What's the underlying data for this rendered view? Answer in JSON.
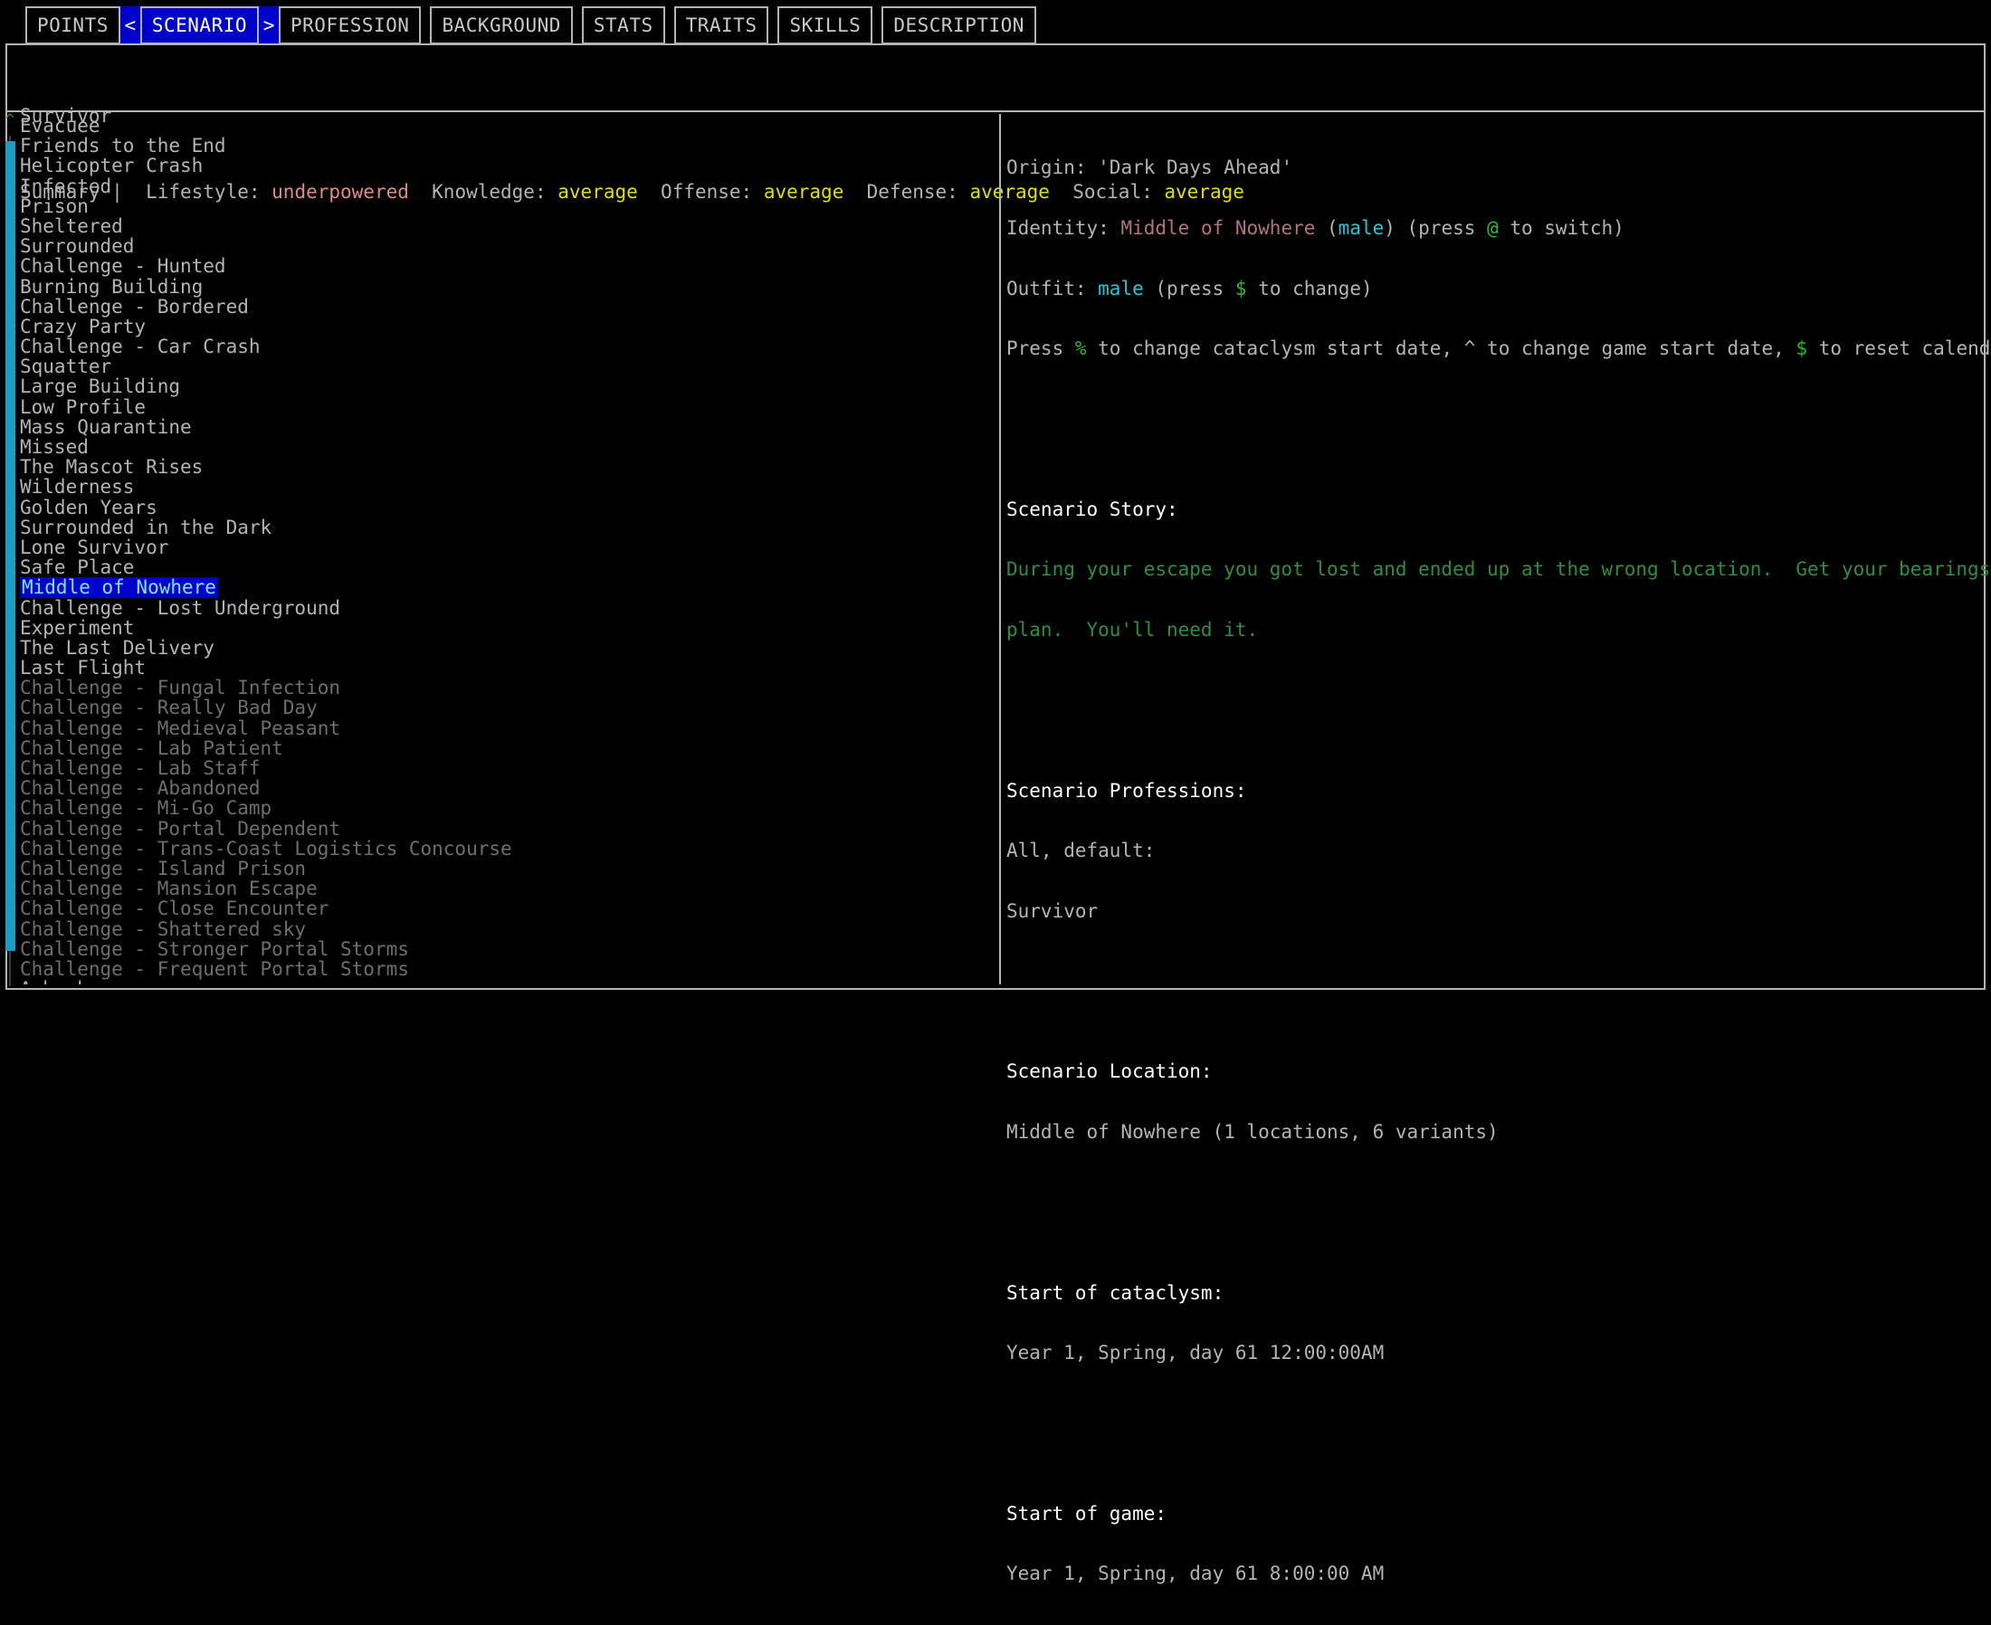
{
  "tabs": [
    {
      "label": "POINTS",
      "active": false
    },
    {
      "label": "SCENARIO",
      "active": true
    },
    {
      "label": "PROFESSION",
      "active": false
    },
    {
      "label": "BACKGROUND",
      "active": false
    },
    {
      "label": "STATS",
      "active": false
    },
    {
      "label": "TRAITS",
      "active": false
    },
    {
      "label": "SKILLS",
      "active": false
    },
    {
      "label": "DESCRIPTION",
      "active": false
    }
  ],
  "tab_arrows": {
    "left": "<",
    "right": ">"
  },
  "summary": {
    "profession": "Survivor",
    "prefix": "Summary |  ",
    "lifestyle_label": "Lifestyle: ",
    "lifestyle_value": "underpowered",
    "knowledge_label": "  Knowledge: ",
    "knowledge_value": "average",
    "offense_label": "  Offense: ",
    "offense_value": "average",
    "defense_label": "  Defense: ",
    "defense_value": "average",
    "social_label": "  Social: ",
    "social_value": "average"
  },
  "scroll": {
    "up_arrow_glyph": "^",
    "thumb_color": "#1b9ec6"
  },
  "scenario_list": [
    {
      "label": "Evacuee",
      "state": "normal"
    },
    {
      "label": "Friends to the End",
      "state": "normal"
    },
    {
      "label": "Helicopter Crash",
      "state": "normal"
    },
    {
      "label": "Infected",
      "state": "normal"
    },
    {
      "label": "Prison",
      "state": "normal"
    },
    {
      "label": "Sheltered",
      "state": "normal"
    },
    {
      "label": "Surrounded",
      "state": "normal"
    },
    {
      "label": "Challenge - Hunted",
      "state": "normal"
    },
    {
      "label": "Burning Building",
      "state": "normal"
    },
    {
      "label": "Challenge - Bordered",
      "state": "normal"
    },
    {
      "label": "Crazy Party",
      "state": "normal"
    },
    {
      "label": "Challenge - Car Crash",
      "state": "normal"
    },
    {
      "label": "Squatter",
      "state": "normal"
    },
    {
      "label": "Large Building",
      "state": "normal"
    },
    {
      "label": "Low Profile",
      "state": "normal"
    },
    {
      "label": "Mass Quarantine",
      "state": "normal"
    },
    {
      "label": "Missed",
      "state": "normal"
    },
    {
      "label": "The Mascot Rises",
      "state": "normal"
    },
    {
      "label": "Wilderness",
      "state": "normal"
    },
    {
      "label": "Golden Years",
      "state": "normal"
    },
    {
      "label": "Surrounded in the Dark",
      "state": "normal"
    },
    {
      "label": "Lone Survivor",
      "state": "normal"
    },
    {
      "label": "Safe Place",
      "state": "normal"
    },
    {
      "label": "Middle of Nowhere",
      "state": "selected"
    },
    {
      "label": "Challenge - Lost Underground",
      "state": "normal"
    },
    {
      "label": "Experiment",
      "state": "normal"
    },
    {
      "label": "The Last Delivery",
      "state": "normal"
    },
    {
      "label": "Last Flight",
      "state": "normal"
    },
    {
      "label": "Challenge - Fungal Infection",
      "state": "dim"
    },
    {
      "label": "Challenge - Really Bad Day",
      "state": "dim"
    },
    {
      "label": "Challenge - Medieval Peasant",
      "state": "dim"
    },
    {
      "label": "Challenge - Lab Patient",
      "state": "dim"
    },
    {
      "label": "Challenge - Lab Staff",
      "state": "dim"
    },
    {
      "label": "Challenge - Abandoned",
      "state": "dim"
    },
    {
      "label": "Challenge - Mi-Go Camp",
      "state": "dim"
    },
    {
      "label": "Challenge - Portal Dependent",
      "state": "dim"
    },
    {
      "label": "Challenge - Trans-Coast Logistics Concourse",
      "state": "dim"
    },
    {
      "label": "Challenge - Island Prison",
      "state": "dim"
    },
    {
      "label": "Challenge - Mansion Escape",
      "state": "dim"
    },
    {
      "label": "Challenge - Close Encounter",
      "state": "dim"
    },
    {
      "label": "Challenge - Shattered sky",
      "state": "dim"
    },
    {
      "label": "Challenge - Stronger Portal Storms",
      "state": "dim"
    },
    {
      "label": "Challenge - Frequent Portal Storms",
      "state": "dim"
    },
    {
      "label": "Ambush",
      "state": "normal"
    }
  ],
  "detail": {
    "origin_label": "Origin: ",
    "origin_value": "'Dark Days Ahead'",
    "identity_label": "Identity: ",
    "identity_value": "Middle of Nowhere",
    "identity_paren_open": " (",
    "identity_gender": "male",
    "identity_paren_close": ") (press ",
    "identity_key": "@",
    "identity_tail": " to switch)",
    "outfit_label": "Outfit: ",
    "outfit_value": "male",
    "outfit_mid": " (press ",
    "outfit_key": "$",
    "outfit_tail": " to change)",
    "press_pre": "Press ",
    "press_key1": "%",
    "press_mid1": " to change cataclysm start date, ",
    "press_key2": "^",
    "press_mid2": " to change game start date, ",
    "press_key3": "$",
    "press_tail": " to reset calendar.",
    "story_header": "Scenario Story:",
    "story_line1": "During your escape you got lost and ended up at the wrong location.  Get your bearings and make a",
    "story_line2": "plan.  You'll need it.",
    "professions_header": "Scenario Professions:",
    "professions_line1": "All, default:",
    "professions_line2": "Survivor",
    "location_header": "Scenario Location:",
    "location_value": "Middle of Nowhere (1 locations, 6 variants)",
    "cataclysm_header": "Start of cataclysm:",
    "cataclysm_value": "Year 1, Spring, day 61 12:00:00AM",
    "game_header": "Start of game:",
    "game_value": "Year 1, Spring, day 61 8:00:00 AM"
  },
  "colors": {
    "selection_bg": "#0000cc",
    "selection_fg": "#7fe8ef",
    "border": "#b4b4b4",
    "scrollbar": "#1b9ec6",
    "accent_green": "#22c022",
    "accent_cyan": "#25c7d4",
    "accent_pink": "#b4737f",
    "story_green": "#2f8f3f",
    "value_yellow": "#e0e000",
    "value_red": "#e08a8a"
  }
}
